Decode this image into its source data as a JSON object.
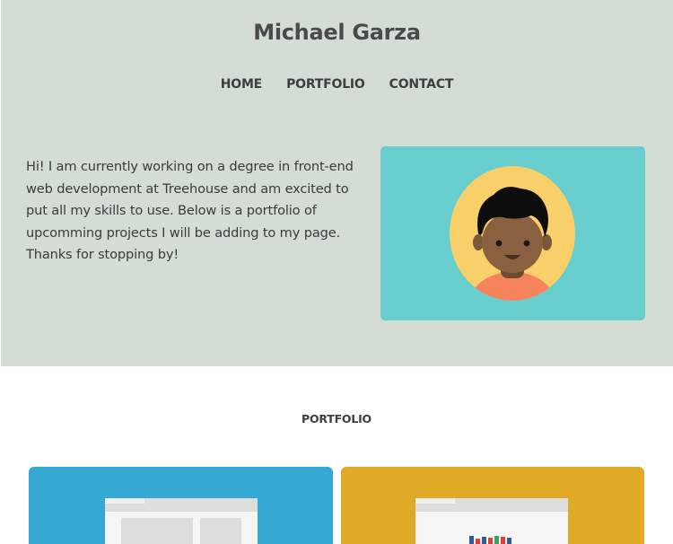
{
  "site": {
    "title": "Michael Garza"
  },
  "nav": {
    "items": [
      {
        "label": "HOME"
      },
      {
        "label": "PORTFOLIO"
      },
      {
        "label": "CONTACT"
      }
    ]
  },
  "intro": {
    "text": "Hi! I am currently working on a degree in front-end web development at Treehouse and am excited to put all my skills to use. Below is a portfolio of upcomming projects I will be adding to my page. Thanks for stopping by!"
  },
  "avatar": {
    "icon": "avatar-illustration",
    "card_color": "#67cdcd",
    "circle_color": "#f9cf6a"
  },
  "portfolio": {
    "heading": "PORTFOLIO",
    "projects": [
      {
        "color": "#35a8d4",
        "icon": "browser-window-icon"
      },
      {
        "color": "#e0a926",
        "icon": "bar-chart-browser-icon"
      }
    ]
  },
  "colors": {
    "hero_bg": "#d3ddd4",
    "text": "#3a3a3a"
  }
}
